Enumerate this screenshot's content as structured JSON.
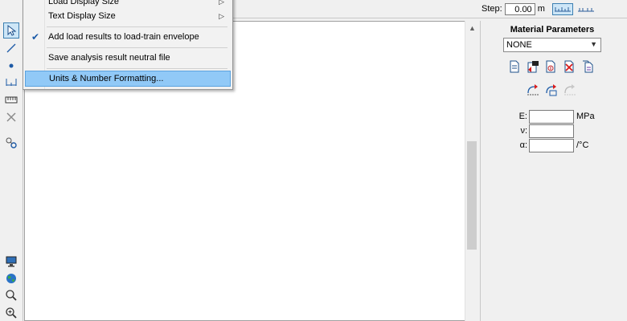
{
  "topbar": {
    "step_label": "Step:",
    "step_value": "0.00",
    "step_unit": "m",
    "snap_icons": [
      "ruler-snap-icon",
      "ruler-free-icon"
    ]
  },
  "menu": {
    "items": [
      {
        "label": "Load Display Size",
        "submenu": true,
        "checked": false
      },
      {
        "label": "Text Display Size",
        "submenu": true,
        "checked": false
      },
      {
        "label": "Add load results to load-train envelope",
        "submenu": false,
        "checked": true
      },
      {
        "label": "Save analysis result neutral file",
        "submenu": false,
        "checked": false
      },
      {
        "label": "Units & Number Formatting...",
        "submenu": false,
        "checked": false,
        "highlighted": true
      }
    ]
  },
  "toolbar": {
    "tools": [
      "select-arrow-icon",
      "line-icon",
      "point-icon",
      "dimension-icon",
      "ruler-icon",
      "delete-icon",
      "link-icon",
      "monitor-icon",
      "globe-icon",
      "zoom-icon",
      "zoom-in-icon"
    ]
  },
  "panel": {
    "title": "Material Parameters",
    "material": "NONE",
    "fields": [
      {
        "label": "E:",
        "value": "",
        "unit": "MPa"
      },
      {
        "label": "ν:",
        "value": "",
        "unit": ""
      },
      {
        "label": "α:",
        "value": "",
        "unit": "/°C"
      }
    ]
  }
}
